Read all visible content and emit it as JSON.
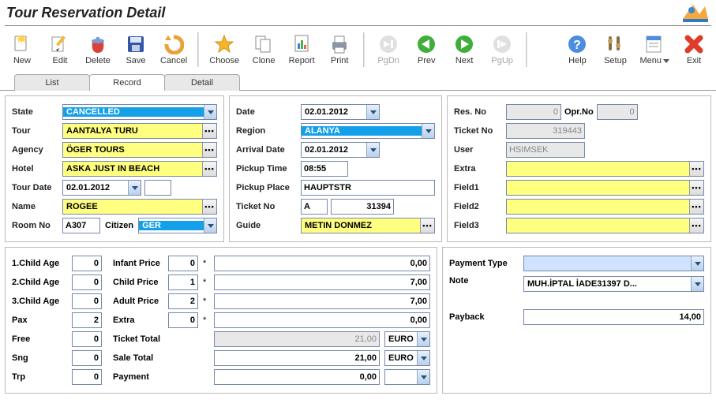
{
  "header": {
    "title": "Tour Reservation Detail"
  },
  "toolbar": {
    "new": "New",
    "edit": "Edit",
    "delete": "Delete",
    "save": "Save",
    "cancel": "Cancel",
    "choose": "Choose",
    "clone": "Clone",
    "report": "Report",
    "print": "Print",
    "pgdn": "PgDn",
    "prev": "Prev",
    "next": "Next",
    "pgup": "PgUp",
    "help": "Help",
    "setup": "Setup",
    "menu": "Menu",
    "exit": "Exit"
  },
  "tabs": {
    "list": "List",
    "record": "Record",
    "detail": "Detail"
  },
  "left": {
    "state_label": "State",
    "state": "CANCELLED",
    "tour_label": "Tour",
    "tour": "AANTALYA TURU",
    "agency_label": "Agency",
    "agency": "ÖGER TOURS",
    "hotel_label": "Hotel",
    "hotel": "ASKA JUST IN BEACH",
    "tourdate_label": "Tour Date",
    "tourdate": "02.01.2012",
    "tourdate_ext": "",
    "name_label": "Name",
    "name": "ROGEE",
    "roomno_label": "Room No",
    "roomno": "A307",
    "citizen_label": "Citizen",
    "citizen": "GER"
  },
  "mid": {
    "date_label": "Date",
    "date": "02.01.2012",
    "region_label": "Region",
    "region": "ALANYA",
    "arrival_label": "Arrival Date",
    "arrival": "02.01.2012",
    "pickuptime_label": "Pickup Time",
    "pickuptime": "08:55",
    "pickupplace_label": "Pickup Place",
    "pickupplace": "HAUPTSTR",
    "ticketno_label": "Ticket No",
    "ticket_prefix": "A",
    "ticket_no": "31394",
    "guide_label": "Guide",
    "guide": "METIN DONMEZ"
  },
  "right": {
    "resno_label": "Res. No",
    "resno": "0",
    "oprno_label": "Opr.No",
    "oprno": "0",
    "ticketno_label": "Ticket No",
    "ticketno": "319443",
    "user_label": "User",
    "user": "HSIMSEK",
    "extra_label": "Extra",
    "field1_label": "Field1",
    "field2_label": "Field2",
    "field3_label": "Field3"
  },
  "num": {
    "child1_label": "1.Child Age",
    "child1": "0",
    "child2_label": "2.Child Age",
    "child2": "0",
    "child3_label": "3.Child Age",
    "child3": "0",
    "pax_label": "Pax",
    "pax": "2",
    "free_label": "Free",
    "free": "0",
    "sng_label": "Sng",
    "sng": "0",
    "trp_label": "Trp",
    "trp": "0",
    "infant_label": "Infant Price",
    "infant": "0",
    "infant_amt": "0,00",
    "childp_label": "Child Price",
    "childp": "1",
    "childp_amt": "7,00",
    "adult_label": "Adult Price",
    "adult": "2",
    "adult_amt": "7,00",
    "extra_label": "Extra",
    "extra": "0",
    "extra_amt": "0,00",
    "tickettot_label": "Ticket Total",
    "tickettot": "21,00",
    "tickettot_cur": "EURO",
    "saletot_label": "Sale Total",
    "saletot": "21,00",
    "saletot_cur": "EURO",
    "payment_label": "Payment",
    "payment": "0,00",
    "payment_cur": ""
  },
  "pay": {
    "paytype_label": "Payment Type",
    "paytype": "",
    "note_label": "Note",
    "note": "MUH.İPTAL İADE31397 D...",
    "payback_label": "Payback",
    "payback": "14,00"
  }
}
